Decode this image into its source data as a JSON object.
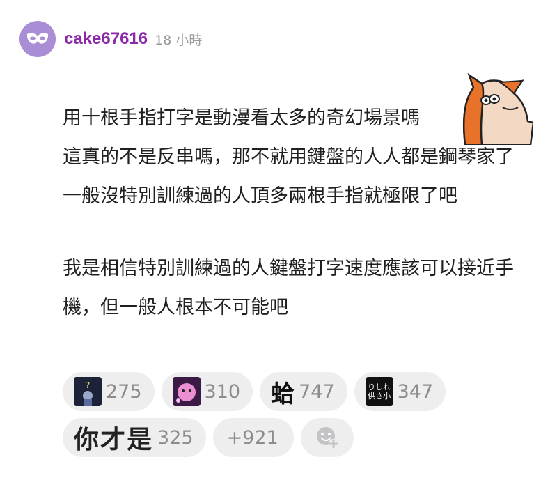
{
  "post": {
    "author": "cake67616",
    "time": "18 小時",
    "lines": [
      "用十根手指打字是動漫看太多的奇幻場景嗎",
      "這真的不是反串嗎，那不就用鍵盤的人人都是鋼琴家了",
      "一般沒特別訓練過的人頂多兩根手指就極限了吧",
      "我是相信特別訓練過的人鍵盤打字速度應該可以接近手機，但一般人根本不可能吧"
    ]
  },
  "reactions": {
    "r1": {
      "icon": "question-character-icon",
      "count": "275"
    },
    "r2": {
      "icon": "pink-character-icon",
      "count": "310"
    },
    "r3": {
      "glyph": "蛤",
      "count": "747"
    },
    "r4": {
      "sign_line1": "りしれ",
      "sign_line2": "供さ小",
      "count": "347"
    },
    "r5": {
      "word": "你才是",
      "count": "325"
    },
    "more": "+921",
    "add_icon": "add-reaction-icon"
  },
  "colors": {
    "username": "#8a2aa8",
    "avatar_bg": "#a98ed6",
    "pill_bg": "#eeeeef",
    "count_text": "#8c8c8c"
  }
}
